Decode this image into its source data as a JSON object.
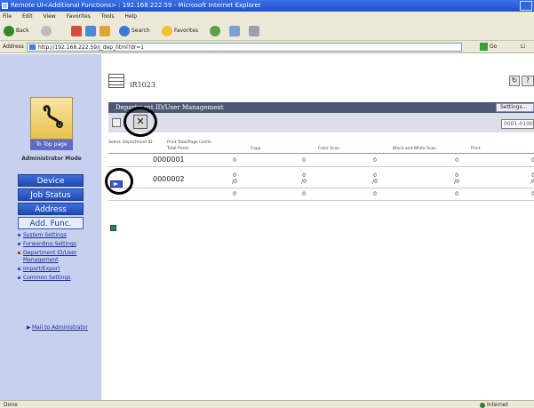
{
  "window": {
    "title": "Remote UI<Additional Functions> : 192.168.222.59 - Microsoft Internet Explorer"
  },
  "menu": {
    "items": [
      "File",
      "Edit",
      "View",
      "Favorites",
      "Tools",
      "Help"
    ]
  },
  "toolbar": {
    "back": "Back",
    "search": "Search",
    "favorites": "Favorites"
  },
  "address": {
    "label": "Address",
    "url": "http://192.168.222.59/j_dep_html?dr=1",
    "go": "Go",
    "links": "Li"
  },
  "sidebar": {
    "top_page": "To Top page",
    "mode": "Administrator Mode",
    "nav": [
      "Device",
      "Job Status",
      "Address",
      "Add. Func."
    ],
    "links": [
      "System Settings",
      "Forwarding Settings",
      "Department ID/User Management",
      "Import/Export",
      "Common Settings"
    ],
    "mail": "Mail to Administrator"
  },
  "main": {
    "device_name": "iR1023",
    "section_title": "Department ID/User Management",
    "settings_label": "Settings...",
    "range_value": "0001-0100",
    "help_glyph": "?",
    "refresh_glyph": "↻",
    "delete_glyph": "✕",
    "columns": {
      "select": "Select",
      "dept_id": "Department ID",
      "print_limits": "Print Total/Page Limits",
      "total_prints": "Total Prints",
      "copy": "Copy",
      "color_scan": "Color Scan",
      "bw_scan": "Black-and-White Scan",
      "print": "Print"
    },
    "rows": [
      {
        "id": "0000001",
        "totals": [
          "0",
          "0",
          "0",
          "0",
          "0"
        ],
        "limits": [
          "",
          "",
          "",
          "",
          ""
        ]
      },
      {
        "id": "0000002",
        "totals": [
          "0",
          "0",
          "0",
          "0",
          "0"
        ],
        "limits": [
          "/0",
          "/0",
          "/0",
          "/0",
          "/0"
        ]
      },
      {
        "id": "",
        "totals": [
          "0",
          "0",
          "0",
          "0",
          "0"
        ],
        "limits": [
          "",
          "",
          "",
          "",
          ""
        ]
      }
    ]
  },
  "status": {
    "done": "Done",
    "zone": "Internet"
  },
  "colors": {
    "title_blue": "#1f4fc8",
    "sidebar_bg": "#c7d0ef",
    "header_bg": "#4d5876",
    "nav_blue": "#2149b4"
  }
}
